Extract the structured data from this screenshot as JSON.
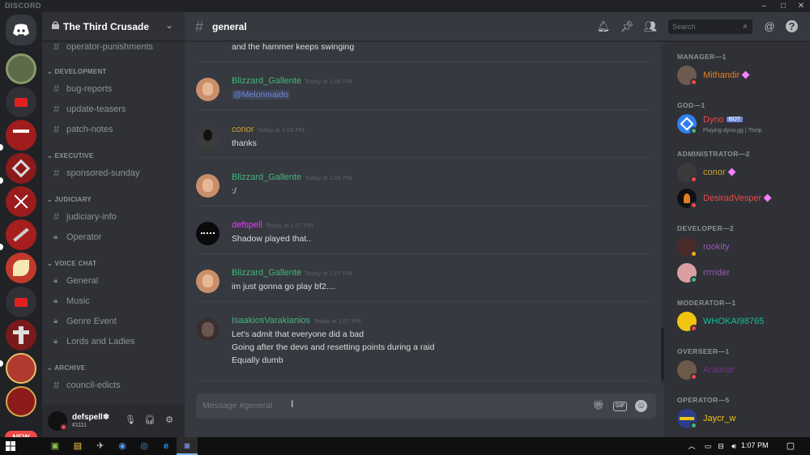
{
  "app": {
    "brand": "DISCORD"
  },
  "window_controls": [
    "–",
    "□",
    "✕"
  ],
  "guild_bar": {
    "new_badge": "NEW"
  },
  "server": {
    "name": "The Third Crusade"
  },
  "channels": {
    "items": [
      {
        "type": "text",
        "name": "operator-punishments"
      },
      {
        "type": "category",
        "name": "DEVELOPMENT"
      },
      {
        "type": "text",
        "name": "bug-reports"
      },
      {
        "type": "text",
        "name": "update-teasers"
      },
      {
        "type": "text",
        "name": "patch-notes"
      },
      {
        "type": "category",
        "name": "EXECUTIVE"
      },
      {
        "type": "text",
        "name": "sponsored-sunday"
      },
      {
        "type": "category",
        "name": "JUDICIARY"
      },
      {
        "type": "text",
        "name": "judiciary-info"
      },
      {
        "type": "voice-locked",
        "name": "Operator"
      },
      {
        "type": "category",
        "name": "VOICE CHAT"
      },
      {
        "type": "voice-locked",
        "name": "General"
      },
      {
        "type": "voice-locked",
        "name": "Music"
      },
      {
        "type": "voice-locked",
        "name": "Genre Event"
      },
      {
        "type": "voice-locked",
        "name": "Lords and Ladies"
      },
      {
        "type": "category",
        "name": "ARCHIVE"
      },
      {
        "type": "text",
        "name": "council-edicts"
      }
    ]
  },
  "user_panel": {
    "username": "defspell❄",
    "tag": "#1111"
  },
  "chat": {
    "channel": "general",
    "search_placeholder": "Search",
    "composer_placeholder": "Message #general",
    "messages": [
      {
        "author": "",
        "time": "",
        "lines": [
          "and the hammer keeps swinging"
        ],
        "color": "#dcddde"
      },
      {
        "author": "Blizzard_Gallente",
        "time": "Today at 1:06 PM",
        "lines": [
          "@Melonmaido"
        ],
        "color": "#43b581"
      },
      {
        "author": "conor",
        "time": "Today at 1:06 PM",
        "lines": [
          "thanks"
        ],
        "color": "#c9a227"
      },
      {
        "author": "Blizzard_Gallente",
        "time": "Today at 1:06 PM",
        "lines": [
          ":/"
        ],
        "color": "#43b581"
      },
      {
        "author": "defspell",
        "time": "Today at 1:07 PM",
        "lines": [
          "Shadow played that.."
        ],
        "color": "#e040fb"
      },
      {
        "author": "Blizzard_Gallente",
        "time": "Today at 1:07 PM",
        "lines": [
          "im just gonna go play bf2...."
        ],
        "color": "#43b581"
      },
      {
        "author": "IsaakiosVarakianios",
        "time": "Today at 1:07 PM",
        "lines": [
          "Let's admit that everyone did a bad",
          "Going after the devs and resetting points during a raid",
          "Equally dumb"
        ],
        "color": "#43b581"
      }
    ]
  },
  "members": {
    "roles": [
      {
        "name": "MANAGER—1",
        "members": [
          {
            "name": "Mithandir",
            "color": "#e67e22",
            "status": "#f04747",
            "gem": true
          }
        ]
      },
      {
        "name": "GOD—1",
        "members": [
          {
            "name": "Dyno",
            "color": "#f04747",
            "status": "#43b581",
            "bot": "BOT",
            "sub": "Playing dyno.gg | ?help"
          }
        ]
      },
      {
        "name": "ADMINISTRATOR—2",
        "members": [
          {
            "name": "conor",
            "color": "#c9a227",
            "status": "#f04747",
            "gem": true
          },
          {
            "name": "DesiradVesper",
            "color": "#f04747",
            "status": "#f04747",
            "gem": true
          }
        ]
      },
      {
        "name": "DEVELOPER—2",
        "members": [
          {
            "name": "rookity",
            "color": "#9b59b6",
            "status": "#faa61a"
          },
          {
            "name": "rrrrider",
            "color": "#9b59b6",
            "status": "#43b581"
          }
        ]
      },
      {
        "name": "MODERATOR—1",
        "members": [
          {
            "name": "WHOKAI98765",
            "color": "#1abc9c",
            "status": "#f04747"
          }
        ]
      },
      {
        "name": "OVERSEER—1",
        "members": [
          {
            "name": "Aratmar",
            "color": "#71368a",
            "status": "#f04747"
          }
        ]
      },
      {
        "name": "OPERATOR—5",
        "members": [
          {
            "name": "Jaycr_w",
            "color": "#f1c40f",
            "status": "#43b581"
          }
        ]
      }
    ]
  },
  "taskbar": {
    "clock": "1:07 PM"
  }
}
